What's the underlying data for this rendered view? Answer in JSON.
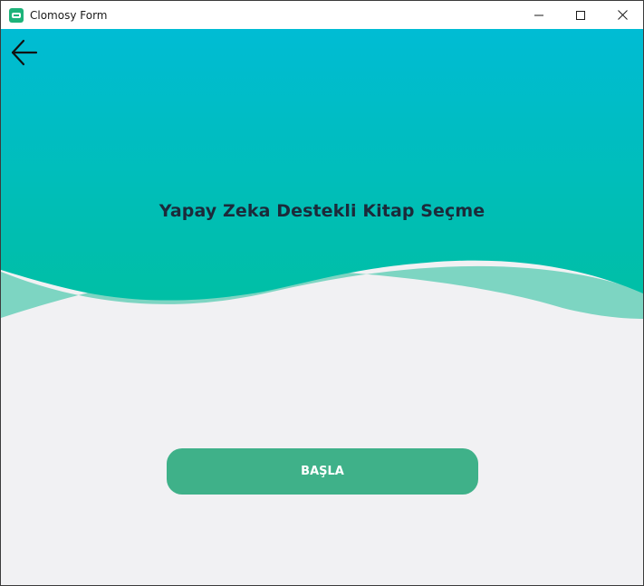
{
  "window": {
    "title": "Clomosy Form",
    "controls": [
      "minimize",
      "maximize",
      "close"
    ]
  },
  "header": {
    "back_icon": "arrow-left-icon",
    "title": "Yapay Zeka Destekli Kitap Seçme",
    "gradient_top": "#00bcd4",
    "gradient_bottom": "#00bfa5",
    "wave_light": "#7dd5c2"
  },
  "main": {
    "start_label": "BAŞLA",
    "button_color": "#3fb189",
    "background": "#f1f1f3"
  }
}
